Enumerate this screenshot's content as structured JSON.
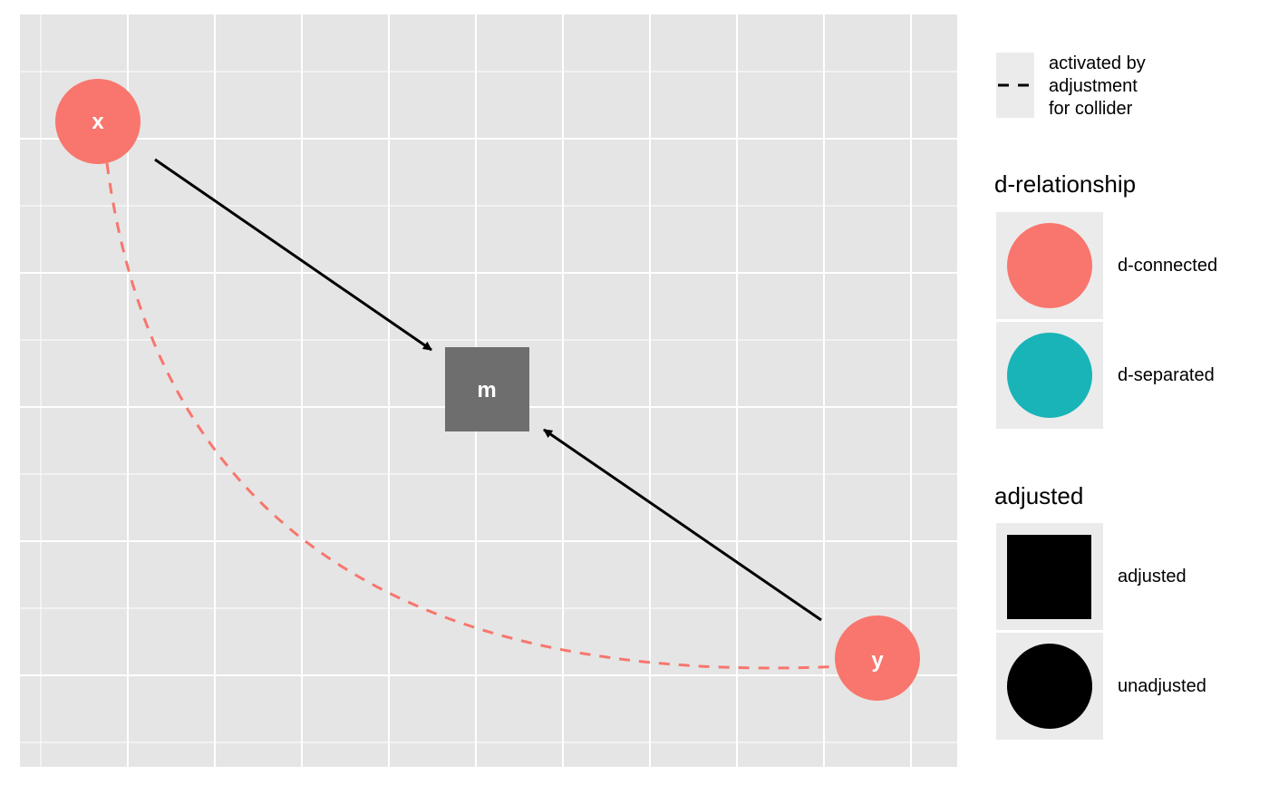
{
  "nodes": [
    {
      "id": "x",
      "label": "x",
      "shape": "circle",
      "status": "d-connected"
    },
    {
      "id": "m",
      "label": "m",
      "shape": "square",
      "status": "adjusted"
    },
    {
      "id": "y",
      "label": "y",
      "shape": "circle",
      "status": "d-connected"
    }
  ],
  "edges": [
    {
      "from": "x",
      "to": "m",
      "style": "solid"
    },
    {
      "from": "y",
      "to": "m",
      "style": "solid"
    },
    {
      "from": "x",
      "to": "y",
      "style": "dashed",
      "meaning": "activated by adjustment for collider"
    }
  ],
  "colors": {
    "d_connected": "#F8766D",
    "d_separated": "#19B4B8",
    "adjusted_node": "#6e6e6e",
    "panel_bg": "#e5e5e5",
    "legend_key_bg": "#ebebeb"
  },
  "legend": {
    "linetype": {
      "label_line1": "activated by",
      "label_line2": "adjustment",
      "label_line3": "for collider"
    },
    "d_relationship": {
      "title": "d-relationship",
      "items": [
        "d-connected",
        "d-separated"
      ]
    },
    "adjusted": {
      "title": "adjusted",
      "items": [
        "adjusted",
        "unadjusted"
      ]
    }
  }
}
